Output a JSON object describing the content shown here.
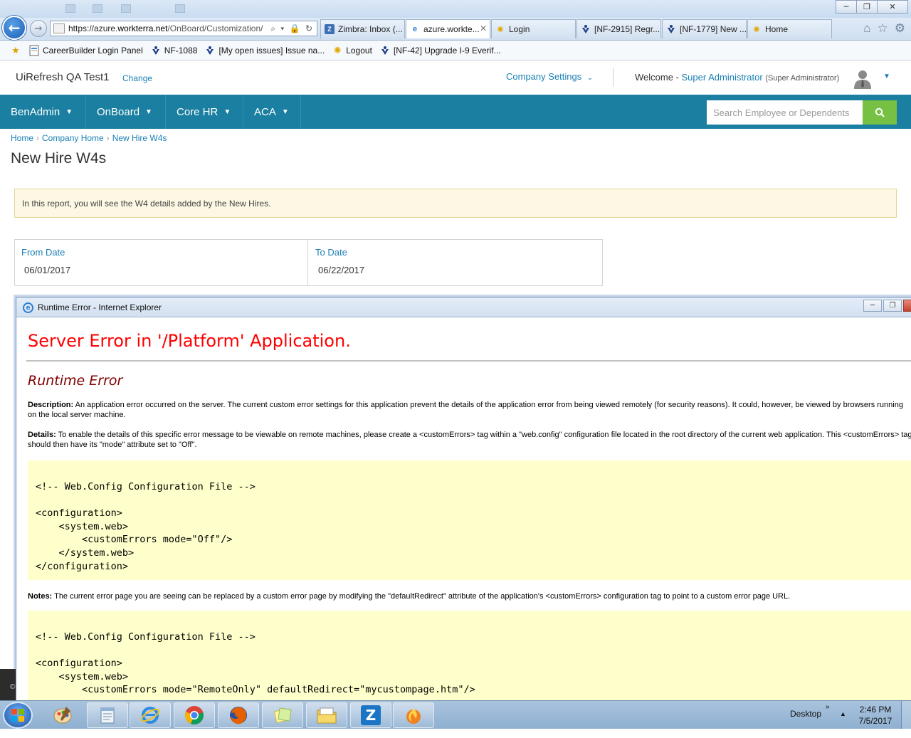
{
  "browser": {
    "back_glyph": "←",
    "forward_glyph": "→",
    "url_prefix": "https://azure.",
    "url_domain": "workterra.net",
    "url_path": "/OnBoard/Customization/",
    "url_tools": "⌕ ▾ 🔒 ↻",
    "tabs": [
      {
        "label": "Zimbra: Inbox (...",
        "icon": "zimbra-icon"
      },
      {
        "label": "azure.workte...",
        "icon": "ie-page-icon",
        "close": "✕"
      },
      {
        "label": "Login",
        "icon": "sun-icon"
      },
      {
        "label": "[NF-2915] Regr...",
        "icon": "jira-icon"
      },
      {
        "label": "[NF-1779] New ...",
        "icon": "jira-icon"
      },
      {
        "label": "Home",
        "icon": "sun-icon"
      }
    ],
    "tool_icons": [
      "home-icon",
      "star-icon",
      "gear-icon"
    ],
    "favorites": [
      {
        "label": "CareerBuilder Login Panel",
        "icon": "page-icon"
      },
      {
        "label": "NF-1088",
        "icon": "jira-icon"
      },
      {
        "label": "[My open issues] Issue na...",
        "icon": "jira-icon"
      },
      {
        "label": "Logout",
        "icon": "sun-icon"
      },
      {
        "label": "[NF-42] Upgrade I-9 Everif...",
        "icon": "jira-icon"
      }
    ],
    "window_controls": {
      "minimize": "─",
      "restore": "❐",
      "close": "✕"
    }
  },
  "header": {
    "company_name": "UiRefresh QA Test1",
    "change_label": "Change",
    "company_settings_label": "Company Settings",
    "welcome_label": "Welcome -",
    "user_name": "Super Administrator",
    "user_role": "(Super Administrator)"
  },
  "nav": {
    "items": [
      "BenAdmin",
      "OnBoard",
      "Core HR",
      "ACA"
    ],
    "search_placeholder": "Search Employee or Dependents"
  },
  "breadcrumb": [
    "Home",
    "Company Home",
    "New Hire W4s"
  ],
  "page_title": "New Hire W4s",
  "info_message": "In this report, you will see the W4 details added by the New Hires.",
  "dates": {
    "from_label": "From Date",
    "from_value": "06/01/2017",
    "to_label": "To Date",
    "to_value": "06/22/2017"
  },
  "popup": {
    "title": "Runtime Error - Internet Explorer",
    "heading": "Server Error in '/Platform' Application.",
    "subheading": "Runtime Error",
    "description_label": "Description:",
    "description_text": "An application error occurred on the server. The current custom error settings for this application prevent the details of the application error from being viewed remotely (for security reasons). It could, however, be viewed by browsers running on the local server machine.",
    "details_label": "Details:",
    "details_text": "To enable the details of this specific error message to be viewable on remote machines, please create a <customErrors> tag within a \"web.config\" configuration file located in the root directory of the current web application. This <customErrors> tag should then have its \"mode\" attribute set to \"Off\".",
    "code1": "<!-- Web.Config Configuration File -->\n\n<configuration>\n    <system.web>\n        <customErrors mode=\"Off\"/>\n    </system.web>\n</configuration>",
    "notes_label": "Notes:",
    "notes_text": "The current error page you are seeing can be replaced by a custom error page by modifying the \"defaultRedirect\" attribute of the application's <customErrors> configuration tag to point to a custom error page URL.",
    "code2": "<!-- Web.Config Configuration File -->\n\n<configuration>\n    <system.web>\n        <customErrors mode=\"RemoteOnly\" defaultRedirect=\"mycustompage.htm\"/>"
  },
  "taskbar": {
    "apps": [
      "paint-icon",
      "notepad-icon",
      "internet-explorer-icon",
      "chrome-icon",
      "firefox-icon",
      "sticky-notes-icon",
      "file-explorer-icon",
      "zimbra-desktop-icon",
      "burn-icon"
    ],
    "zimbra_letter": "Z",
    "desktop_label": "Desktop",
    "chevron": "»",
    "tray_up": "▲",
    "time": "2:46 PM",
    "date": "7/5/2017",
    "edge_glyph": "©"
  },
  "colors": {
    "nav_bg": "#1a7fa0",
    "link": "#1a7fb3",
    "search_button": "#76c043",
    "info_bg": "#fcf8e3",
    "error_red": "#ff0000",
    "error_maroon": "#800000",
    "code_bg": "#ffffcc"
  }
}
